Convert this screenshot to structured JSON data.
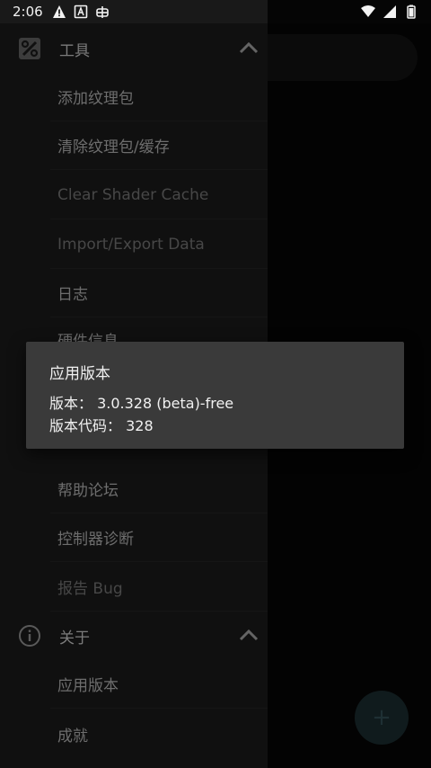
{
  "status_bar": {
    "time": "2:06",
    "icons_left": [
      "warning-icon",
      "a-box-icon",
      "bug-icon"
    ],
    "icons_right": [
      "wifi-icon",
      "signal-icon",
      "battery-icon"
    ]
  },
  "drawer": {
    "tools_section": {
      "title": "工具",
      "icon": "tools-icon",
      "items": [
        {
          "label": "添加纹理包",
          "enabled": true
        },
        {
          "label": "清除纹理包/缓存",
          "enabled": true
        },
        {
          "label": "Clear Shader Cache",
          "enabled": false
        },
        {
          "label": "Import/Export Data",
          "enabled": false
        },
        {
          "label": "日志",
          "enabled": true
        },
        {
          "label": "硬件信息",
          "enabled": true
        }
      ]
    },
    "help_items": [
      {
        "label": "帮助论坛",
        "enabled": true
      },
      {
        "label": "控制器诊断",
        "enabled": true
      },
      {
        "label": "报告 Bug",
        "enabled": false
      }
    ],
    "about_section": {
      "title": "关于",
      "icon": "info-icon",
      "items": [
        {
          "label": "应用版本",
          "enabled": true
        },
        {
          "label": "成就",
          "enabled": true
        }
      ]
    }
  },
  "dialog": {
    "title": "应用版本",
    "version_line": "版本： 3.0.328 (beta)-free",
    "code_line": "版本代码： 328"
  },
  "fab": {
    "label": "+"
  },
  "colors": {
    "drawer_bg": "#191919",
    "dialog_bg": "#3a3a3a",
    "fab_bg": "#1a2a2d"
  }
}
